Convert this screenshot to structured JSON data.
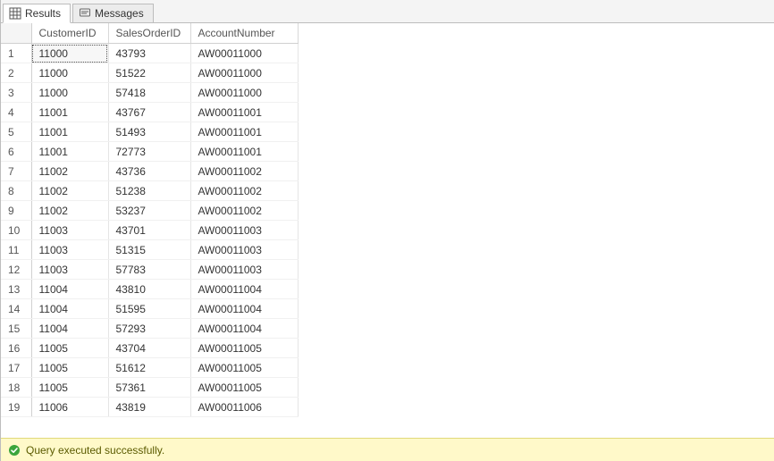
{
  "tabs": {
    "results": "Results",
    "messages": "Messages"
  },
  "columns": {
    "customer": "CustomerID",
    "order": "SalesOrderID",
    "account": "AccountNumber"
  },
  "rows": [
    {
      "n": "1",
      "customer": "11000",
      "order": "43793",
      "account": "AW00011000"
    },
    {
      "n": "2",
      "customer": "11000",
      "order": "51522",
      "account": "AW00011000"
    },
    {
      "n": "3",
      "customer": "11000",
      "order": "57418",
      "account": "AW00011000"
    },
    {
      "n": "4",
      "customer": "11001",
      "order": "43767",
      "account": "AW00011001"
    },
    {
      "n": "5",
      "customer": "11001",
      "order": "51493",
      "account": "AW00011001"
    },
    {
      "n": "6",
      "customer": "11001",
      "order": "72773",
      "account": "AW00011001"
    },
    {
      "n": "7",
      "customer": "11002",
      "order": "43736",
      "account": "AW00011002"
    },
    {
      "n": "8",
      "customer": "11002",
      "order": "51238",
      "account": "AW00011002"
    },
    {
      "n": "9",
      "customer": "11002",
      "order": "53237",
      "account": "AW00011002"
    },
    {
      "n": "10",
      "customer": "11003",
      "order": "43701",
      "account": "AW00011003"
    },
    {
      "n": "11",
      "customer": "11003",
      "order": "51315",
      "account": "AW00011003"
    },
    {
      "n": "12",
      "customer": "11003",
      "order": "57783",
      "account": "AW00011003"
    },
    {
      "n": "13",
      "customer": "11004",
      "order": "43810",
      "account": "AW00011004"
    },
    {
      "n": "14",
      "customer": "11004",
      "order": "51595",
      "account": "AW00011004"
    },
    {
      "n": "15",
      "customer": "11004",
      "order": "57293",
      "account": "AW00011004"
    },
    {
      "n": "16",
      "customer": "11005",
      "order": "43704",
      "account": "AW00011005"
    },
    {
      "n": "17",
      "customer": "11005",
      "order": "51612",
      "account": "AW00011005"
    },
    {
      "n": "18",
      "customer": "11005",
      "order": "57361",
      "account": "AW00011005"
    },
    {
      "n": "19",
      "customer": "11006",
      "order": "43819",
      "account": "AW00011006"
    }
  ],
  "selected": {
    "row": 0,
    "col": "customer"
  },
  "status": {
    "message": "Query executed successfully."
  }
}
